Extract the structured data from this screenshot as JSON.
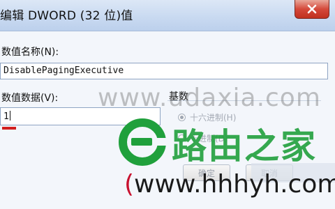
{
  "window": {
    "title": "编辑 DWORD (32 位)值",
    "close_icon": "close-icon"
  },
  "fields": {
    "name_label": "数值名称(N):",
    "name_value": "DisablePagingExecutive",
    "data_label": "数值数据(V):",
    "data_value": "1"
  },
  "base": {
    "label": "基数",
    "options": [
      {
        "label": "十六进制(H)",
        "checked": true
      },
      {
        "label": "十进制(D)",
        "checked": false
      }
    ]
  },
  "buttons": {
    "ok": "确定",
    "cancel": "取消"
  },
  "watermarks": {
    "site_top": "www.udaxia.com",
    "brand": "路由之家",
    "site_bottom": "www.hhhyh.com",
    "paren": "("
  },
  "colors": {
    "title_bar": "#c9daf1",
    "close_button": "#d5493a",
    "brand_green": "#20a03c",
    "underline_red": "#d21f1f"
  }
}
